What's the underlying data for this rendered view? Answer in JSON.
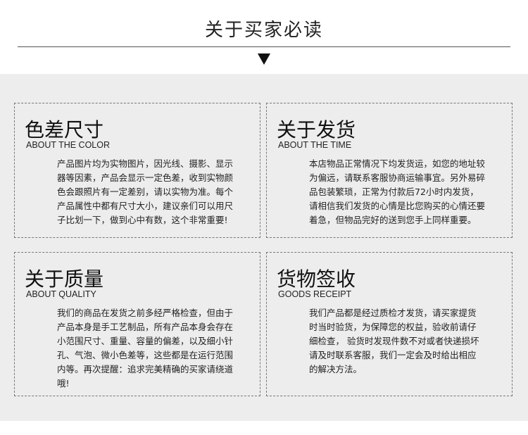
{
  "header": {
    "title": "关于买家必读"
  },
  "cards": [
    {
      "heading": "色差尺寸",
      "subheading": "ABOUT THE COLOR",
      "body": [
        "产品图片均为实物图片，因光线、摄影、显示",
        "器等因素，产品会显示一定色差，收到实物颜",
        "色会跟照片有一定差别，请以实物为准。每个",
        "产品属性中都有尺寸大小，建议亲们可以用尺",
        "子比划一下，做到心中有数，这个非常重要!"
      ]
    },
    {
      "heading": "关于发货",
      "subheading": "ABOUT THE TIME",
      "body": [
        "本店物品正常情况下均发货运，如您的地址较",
        "为偏远，请联系客服协商运输事宜。另外易碎",
        "品包装繁琐，正常为付款后72小时内发货，",
        "请相信我们发货的心情是比您购买的心情还要",
        "着急，但物品完好的送到您手上同样重要。"
      ]
    },
    {
      "heading": "关于质量",
      "subheading": "ABOUT QUALITY",
      "body": [
        "我们的商品在发货之前多经严格检查，但由于",
        "产品本身是手工艺制品，所有产品本身会存在",
        "小范围尺寸、重量、容量的偏差，以及细小针",
        "孔、气泡、微小色差等，这些都是在运行范围",
        "内等。再次提醒：追求完美精确的买家请绕道",
        "哦!"
      ]
    },
    {
      "heading": "货物签收",
      "subheading": "GOODS RECEIPT",
      "body": [
        "我们产品都是经过质检才发货，请买家提货",
        "时当时验货，为保障您的权益，验收前请仔",
        "细检查，  验货时发现件数不对或者快递损坏",
        "请及时联系客服，我们一定会及时给出相应",
        "的解决方法。"
      ]
    }
  ]
}
